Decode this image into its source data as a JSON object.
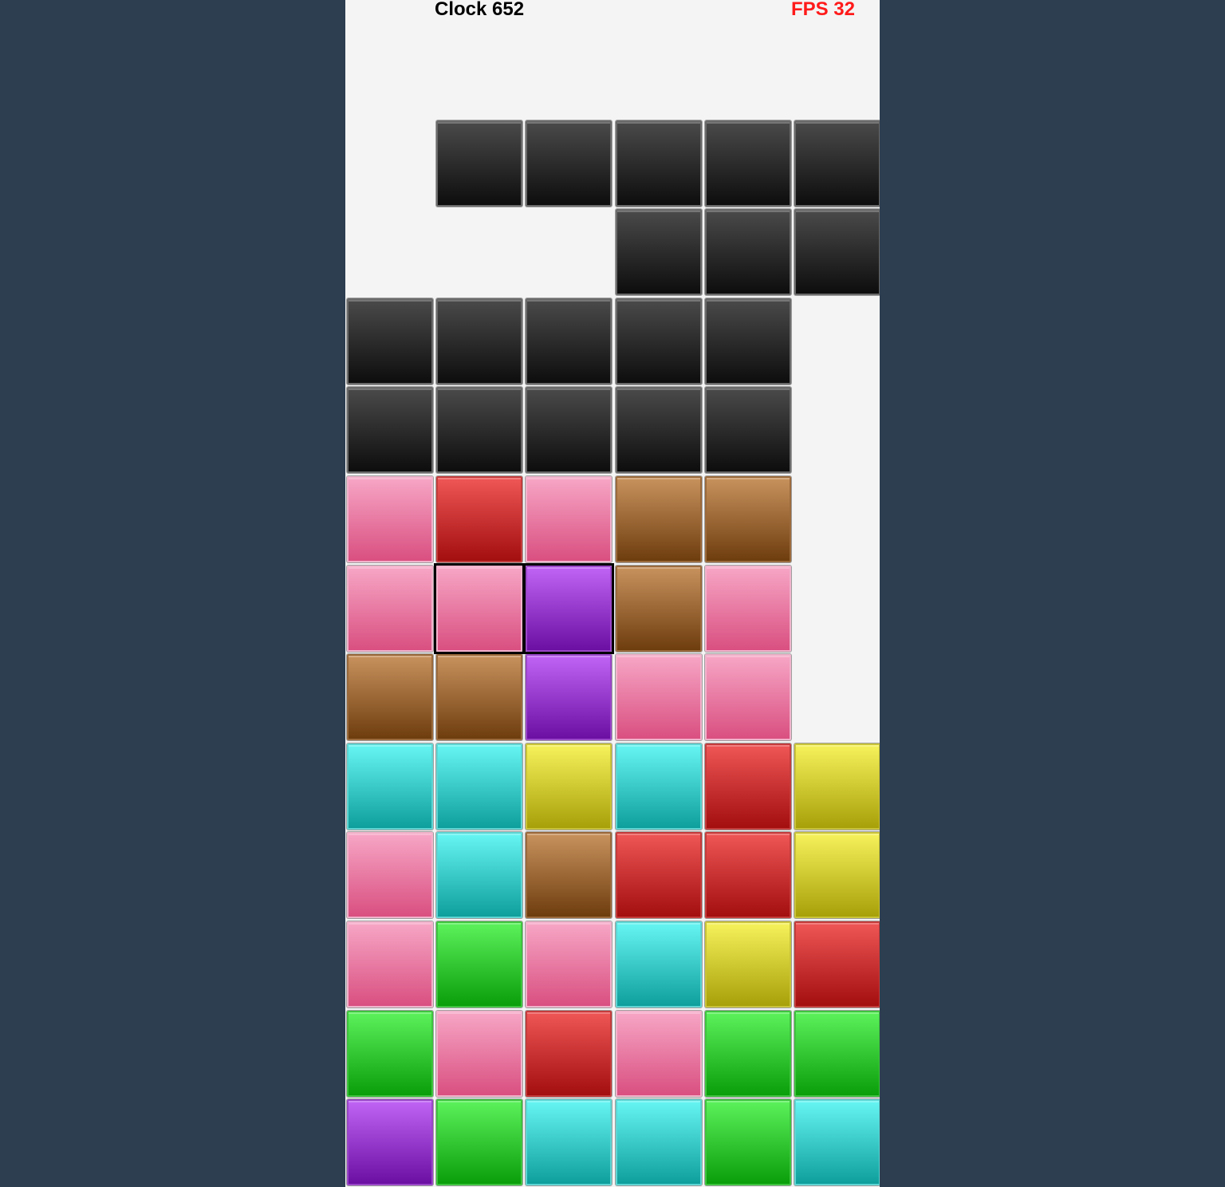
{
  "hud": {
    "clock_label": "Clock 652",
    "fps_label": "FPS 32",
    "fps_color": "#ff1a1a"
  },
  "board": {
    "columns": 6,
    "rows": 13,
    "background": "#f4f4f4",
    "palette": {
      "black": {
        "top": "#4a4a4a",
        "bottom": "#0d0d0d",
        "border": "#6a6a6a"
      },
      "pink": {
        "top": "#f7a6c5",
        "bottom": "#d94f80",
        "border": "#f1b3cb"
      },
      "red": {
        "top": "#ef5656",
        "bottom": "#a30e0e",
        "border": "#c43c3c"
      },
      "brown": {
        "top": "#c8925d",
        "bottom": "#6e3d0e",
        "border": "#9b6a3c"
      },
      "purple": {
        "top": "#c064f5",
        "bottom": "#6b0fa3",
        "border": "#9a47c7"
      },
      "cyan": {
        "top": "#66f5f3",
        "bottom": "#0e9e9c",
        "border": "#5fd5d3"
      },
      "yellow": {
        "top": "#f6f25b",
        "bottom": "#a8a008",
        "border": "#c9c33a"
      },
      "green": {
        "top": "#5cf25c",
        "bottom": "#0a9e0a",
        "border": "#3fc43f"
      }
    },
    "tiles": [
      {
        "row": 1,
        "col": 1,
        "color": "black"
      },
      {
        "row": 1,
        "col": 2,
        "color": "black"
      },
      {
        "row": 1,
        "col": 3,
        "color": "black"
      },
      {
        "row": 1,
        "col": 4,
        "color": "black"
      },
      {
        "row": 1,
        "col": 5,
        "color": "black"
      },
      {
        "row": 2,
        "col": 3,
        "color": "black"
      },
      {
        "row": 2,
        "col": 4,
        "color": "black"
      },
      {
        "row": 2,
        "col": 5,
        "color": "black"
      },
      {
        "row": 3,
        "col": 0,
        "color": "black"
      },
      {
        "row": 3,
        "col": 1,
        "color": "black"
      },
      {
        "row": 3,
        "col": 2,
        "color": "black"
      },
      {
        "row": 3,
        "col": 3,
        "color": "black"
      },
      {
        "row": 3,
        "col": 4,
        "color": "black"
      },
      {
        "row": 4,
        "col": 0,
        "color": "black"
      },
      {
        "row": 4,
        "col": 1,
        "color": "black"
      },
      {
        "row": 4,
        "col": 2,
        "color": "black"
      },
      {
        "row": 4,
        "col": 3,
        "color": "black"
      },
      {
        "row": 4,
        "col": 4,
        "color": "black"
      },
      {
        "row": 5,
        "col": 0,
        "color": "pink"
      },
      {
        "row": 5,
        "col": 1,
        "color": "red"
      },
      {
        "row": 5,
        "col": 2,
        "color": "pink"
      },
      {
        "row": 5,
        "col": 3,
        "color": "brown"
      },
      {
        "row": 5,
        "col": 4,
        "color": "brown"
      },
      {
        "row": 6,
        "col": 0,
        "color": "pink"
      },
      {
        "row": 6,
        "col": 1,
        "color": "pink",
        "selected": true
      },
      {
        "row": 6,
        "col": 2,
        "color": "purple",
        "selected": true
      },
      {
        "row": 6,
        "col": 3,
        "color": "brown"
      },
      {
        "row": 6,
        "col": 4,
        "color": "pink"
      },
      {
        "row": 7,
        "col": 0,
        "color": "brown"
      },
      {
        "row": 7,
        "col": 1,
        "color": "brown"
      },
      {
        "row": 7,
        "col": 2,
        "color": "purple"
      },
      {
        "row": 7,
        "col": 3,
        "color": "pink"
      },
      {
        "row": 7,
        "col": 4,
        "color": "pink"
      },
      {
        "row": 8,
        "col": 0,
        "color": "cyan"
      },
      {
        "row": 8,
        "col": 1,
        "color": "cyan"
      },
      {
        "row": 8,
        "col": 2,
        "color": "yellow"
      },
      {
        "row": 8,
        "col": 3,
        "color": "cyan"
      },
      {
        "row": 8,
        "col": 4,
        "color": "red"
      },
      {
        "row": 8,
        "col": 5,
        "color": "yellow"
      },
      {
        "row": 9,
        "col": 0,
        "color": "pink"
      },
      {
        "row": 9,
        "col": 1,
        "color": "cyan"
      },
      {
        "row": 9,
        "col": 2,
        "color": "brown"
      },
      {
        "row": 9,
        "col": 3,
        "color": "red"
      },
      {
        "row": 9,
        "col": 4,
        "color": "red"
      },
      {
        "row": 9,
        "col": 5,
        "color": "yellow"
      },
      {
        "row": 10,
        "col": 0,
        "color": "pink"
      },
      {
        "row": 10,
        "col": 1,
        "color": "green"
      },
      {
        "row": 10,
        "col": 2,
        "color": "pink"
      },
      {
        "row": 10,
        "col": 3,
        "color": "cyan"
      },
      {
        "row": 10,
        "col": 4,
        "color": "yellow"
      },
      {
        "row": 10,
        "col": 5,
        "color": "red"
      },
      {
        "row": 11,
        "col": 0,
        "color": "green"
      },
      {
        "row": 11,
        "col": 1,
        "color": "pink"
      },
      {
        "row": 11,
        "col": 2,
        "color": "red"
      },
      {
        "row": 11,
        "col": 3,
        "color": "pink"
      },
      {
        "row": 11,
        "col": 4,
        "color": "green"
      },
      {
        "row": 11,
        "col": 5,
        "color": "green"
      },
      {
        "row": 12,
        "col": 0,
        "color": "purple"
      },
      {
        "row": 12,
        "col": 1,
        "color": "green"
      },
      {
        "row": 12,
        "col": 2,
        "color": "cyan"
      },
      {
        "row": 12,
        "col": 3,
        "color": "cyan"
      },
      {
        "row": 12,
        "col": 4,
        "color": "green"
      },
      {
        "row": 12,
        "col": 5,
        "color": "cyan"
      }
    ]
  }
}
